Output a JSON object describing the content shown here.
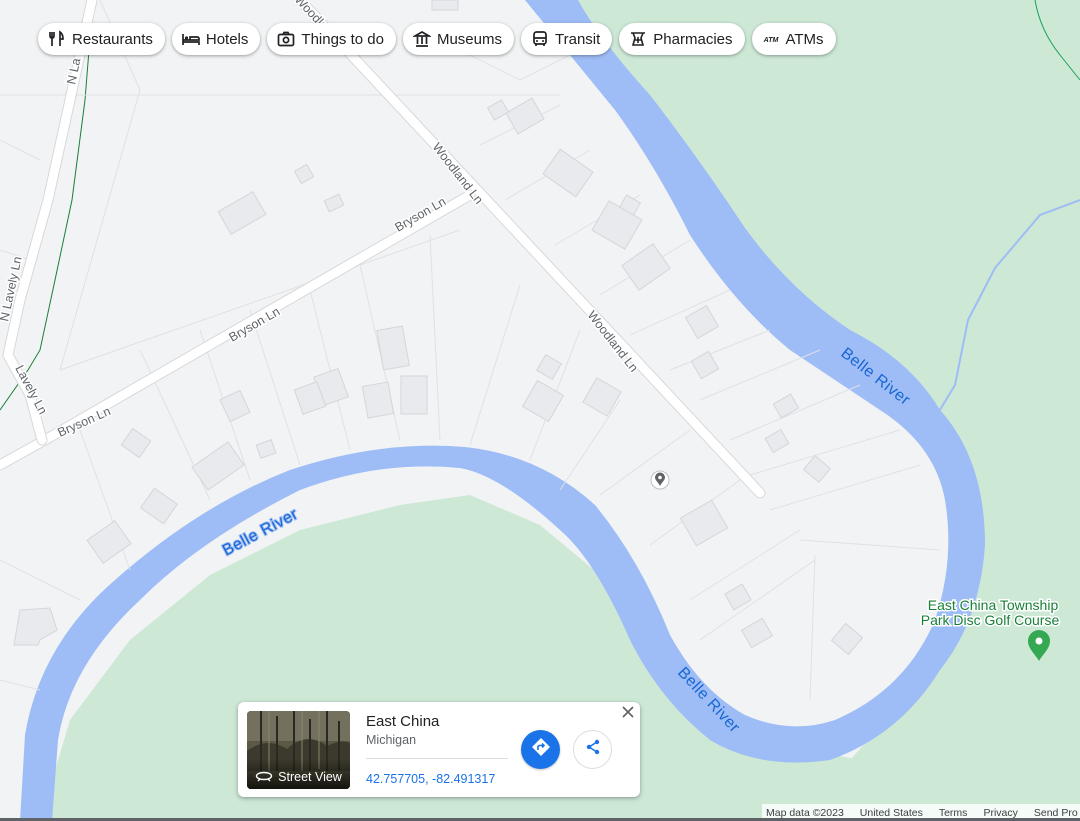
{
  "chips": [
    {
      "label": "Restaurants",
      "icon": "fork-knife-icon"
    },
    {
      "label": "Hotels",
      "icon": "bed-icon"
    },
    {
      "label": "Things to do",
      "icon": "camera-icon"
    },
    {
      "label": "Museums",
      "icon": "museum-icon"
    },
    {
      "label": "Transit",
      "icon": "bus-icon"
    },
    {
      "label": "Pharmacies",
      "icon": "pharmacy-icon"
    },
    {
      "label": "ATMs",
      "icon": "atm-icon"
    }
  ],
  "map": {
    "colors": {
      "land": "#f1f3f4",
      "park": "#cde8d5",
      "water": "#9ebcf6",
      "road": "#ffffff",
      "road_edge": "#d6d8db",
      "label_road": "#5f6368",
      "label_water": "#1967d2",
      "label_park": "#188038"
    },
    "road_labels": [
      "Woodland Ln",
      "Woodland Ln",
      "Woodland Ln",
      "Bryson Ln",
      "Bryson Ln",
      "Bryson Ln",
      "N Lavely Ln",
      "Lavely Ln",
      "N La"
    ],
    "water_labels": [
      "Belle River",
      "Belle River",
      "Belle River"
    ],
    "poi": {
      "name_line1": "East China Township",
      "name_line2": "Park Disc Golf Course"
    }
  },
  "place_card": {
    "title": "East China",
    "subtitle": "Michigan",
    "coordinates": "42.757705, -82.491317",
    "street_view_label": "Street View"
  },
  "footer": {
    "map_data": "Map data ©2023",
    "country": "United States",
    "terms": "Terms",
    "privacy": "Privacy",
    "feedback": "Send Pro"
  }
}
